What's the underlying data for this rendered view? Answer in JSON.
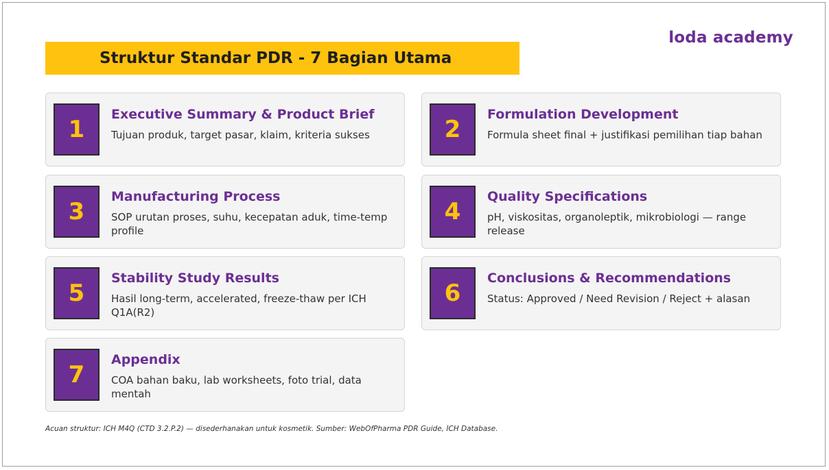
{
  "brand": {
    "logo_text": "loda academy",
    "color": "#6a2f94"
  },
  "title": "Struktur Standar PDR - 7 Bagian Utama",
  "colors": {
    "accent_yellow": "#ffc20e",
    "accent_purple": "#6b2f93",
    "card_bg": "#f4f4f4"
  },
  "sections": [
    {
      "number": "1",
      "title": "Executive Summary & Product Brief",
      "description": "Tujuan produk, target pasar, klaim, kriteria sukses"
    },
    {
      "number": "2",
      "title": "Formulation Development",
      "description": "Formula sheet final + justifikasi pemilihan tiap bahan"
    },
    {
      "number": "3",
      "title": "Manufacturing Process",
      "description": "SOP urutan proses, suhu, kecepatan aduk, time-temp profile"
    },
    {
      "number": "4",
      "title": "Quality Specifications",
      "description": "pH, viskositas, organoleptik, mikrobiologi — range release"
    },
    {
      "number": "5",
      "title": "Stability Study Results",
      "description": "Hasil long-term, accelerated, freeze-thaw per ICH Q1A(R2)"
    },
    {
      "number": "6",
      "title": "Conclusions & Recommendations",
      "description": "Status: Approved / Need Revision / Reject + alasan"
    },
    {
      "number": "7",
      "title": "Appendix",
      "description": "COA bahan baku, lab worksheets, foto trial, data mentah"
    }
  ],
  "footnote": "Acuan struktur: ICH M4Q (CTD 3.2.P.2) — disederhanakan untuk kosmetik. Sumber: WebOfPharma PDR Guide, ICH Database."
}
